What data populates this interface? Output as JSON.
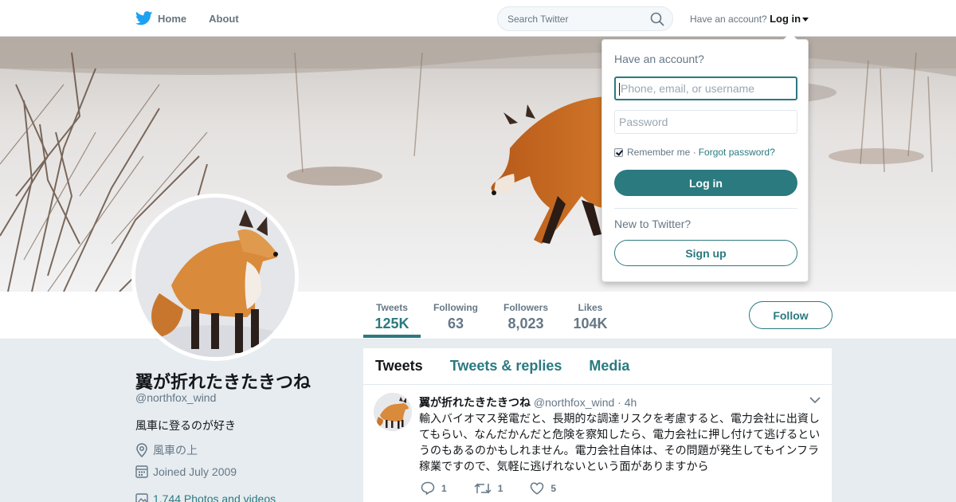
{
  "nav": {
    "home_label": "Home",
    "about_label": "About",
    "search_placeholder": "Search Twitter",
    "have_account_text": "Have an account?",
    "login_label": "Log in"
  },
  "login_dropdown": {
    "title": "Have an account?",
    "username_placeholder": "Phone, email, or username",
    "password_placeholder": "Password",
    "remember_me": "Remember me",
    "separator": "·",
    "forgot_password": "Forgot password?",
    "remember_checked": true,
    "login_button": "Log in",
    "new_to_twitter": "New to Twitter?",
    "signup_button": "Sign up"
  },
  "stats": [
    {
      "label": "Tweets",
      "value": "125K"
    },
    {
      "label": "Following",
      "value": "63"
    },
    {
      "label": "Followers",
      "value": "8,023"
    },
    {
      "label": "Likes",
      "value": "104K"
    }
  ],
  "follow_button": "Follow",
  "profile": {
    "name": "翼が折れたきたきつね",
    "handle": "@northfox_wind",
    "bio": "風車に登るのが好き",
    "location": "風車の上",
    "joined": "Joined July 2009",
    "photos_videos": "1,744 Photos and videos"
  },
  "timeline": {
    "tabs": [
      "Tweets",
      "Tweets & replies",
      "Media"
    ],
    "tweet": {
      "name": "翼が折れたきたきつね",
      "handle": "@northfox_wind",
      "separator": "·",
      "time": "4h",
      "text": "輸入バイオマス発電だと、長期的な調達リスクを考慮すると、電力会社に出資してもらい、なんだかんだと危険を察知したら、電力会社に押し付けて逃げるというのもあるのかもしれません。電力会社自体は、その問題が発生してもインフラ稼業ですので、気軽に逃げれないという面がありますから",
      "replies": "1",
      "retweets": "1",
      "likes": "5"
    }
  },
  "colors": {
    "accent": "#2a7a80",
    "twitter_blue": "#1da1f2"
  }
}
